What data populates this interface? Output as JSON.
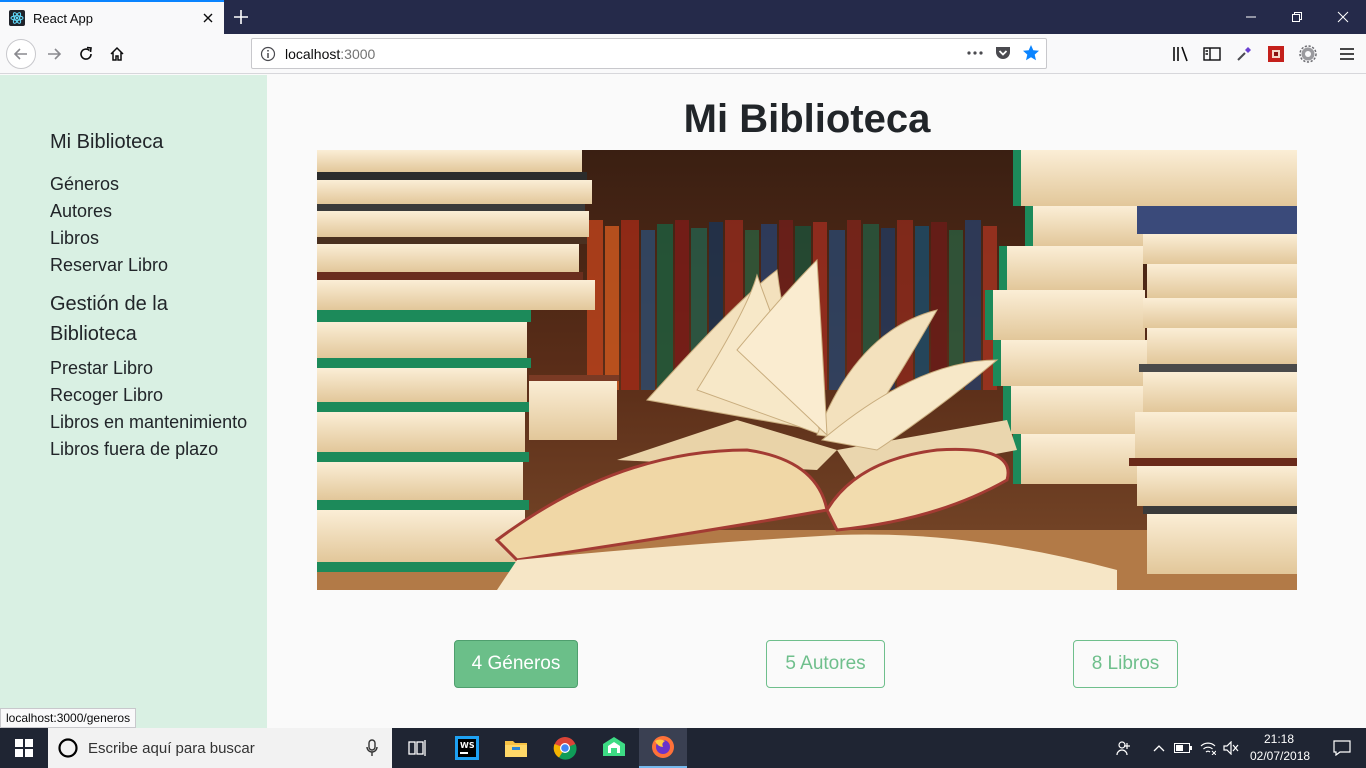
{
  "browser": {
    "tab_title": "React App",
    "url_host": "localhost",
    "url_port": ":3000",
    "status_url": "localhost:3000/generos",
    "accent": "#0a84ff"
  },
  "sidebar": {
    "brand": "Mi Biblioteca",
    "links": [
      "Géneros",
      "Autores",
      "Libros",
      "Reservar Libro"
    ],
    "section_title": "Gestión de la Biblioteca",
    "section_links": [
      "Prestar Libro",
      "Recoger Libro",
      "Libros en mantenimiento",
      "Libros fuera de plazo"
    ],
    "background": "#d9f0e3"
  },
  "main": {
    "title": "Mi Biblioteca",
    "buttons": [
      {
        "label": "4 Géneros",
        "active": true
      },
      {
        "label": "5 Autores",
        "active": false
      },
      {
        "label": "8 Libros",
        "active": false
      }
    ],
    "accent": "#6bbf89"
  },
  "taskbar": {
    "search_placeholder": "Escribe aquí para buscar",
    "time": "21:18",
    "date": "02/07/2018"
  },
  "icons": [
    "react-icon",
    "close-icon",
    "plus-icon",
    "back-icon",
    "forward-icon",
    "reload-icon",
    "home-icon",
    "info-icon",
    "more-icon",
    "pocket-icon",
    "star-icon",
    "library-icon",
    "sidebar-icon",
    "eyedropper-icon",
    "extension-icon",
    "settings-icon",
    "menu-icon",
    "windows-icon",
    "cortana-icon",
    "mic-icon"
  ]
}
